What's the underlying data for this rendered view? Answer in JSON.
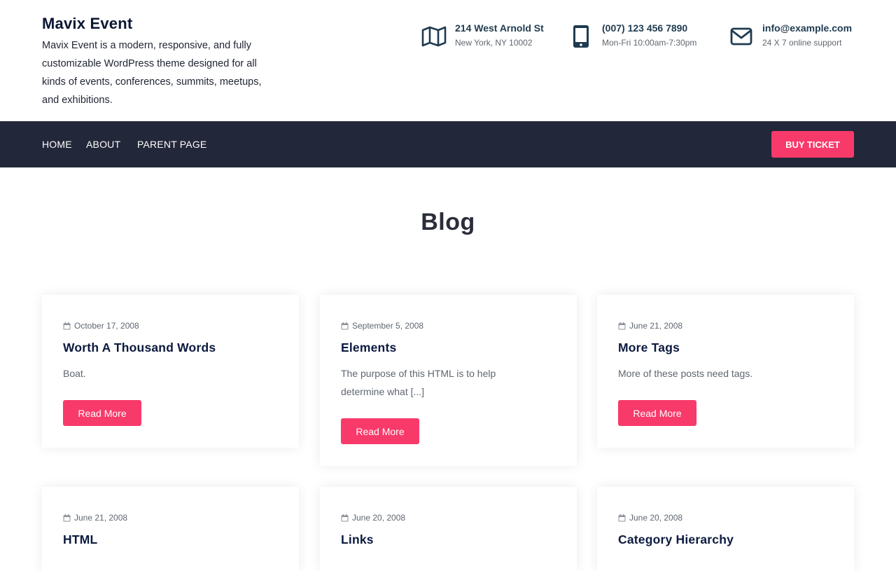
{
  "site": {
    "title": "Mavix Event",
    "description": "Mavix Event is a modern, responsive, and fully customizable WordPress theme designed for all kinds of events, conferences, summits, meetups, and exhibitions."
  },
  "contacts": {
    "address": {
      "icon": "map-icon",
      "line1": "214 West Arnold St",
      "line2": "New York, NY 10002"
    },
    "phone": {
      "icon": "mobile-phone-icon",
      "line1": "(007) 123 456 7890",
      "line2": "Mon-Fri 10:00am-7:30pm"
    },
    "email": {
      "icon": "envelope-icon",
      "line1": "info@example.com",
      "line2": "24 X 7 online support"
    }
  },
  "nav": {
    "items": [
      {
        "label": "HOME"
      },
      {
        "label": "ABOUT"
      },
      {
        "label": "PARENT PAGE"
      }
    ],
    "cta": "BUY TICKET"
  },
  "page": {
    "title": "Blog"
  },
  "posts": [
    {
      "date": "October 17, 2008",
      "title": "Worth A Thousand Words",
      "excerpt": "Boat.",
      "button": "Read More"
    },
    {
      "date": "September 5, 2008",
      "title": "Elements",
      "excerpt": "The purpose of this HTML is to help determine what [...]",
      "button": "Read More"
    },
    {
      "date": "June 21, 2008",
      "title": "More Tags",
      "excerpt": "More of these posts need tags.",
      "button": "Read More"
    },
    {
      "date": "June 21, 2008",
      "title": "HTML",
      "excerpt": "",
      "button": ""
    },
    {
      "date": "June 20, 2008",
      "title": "Links",
      "excerpt": "",
      "button": ""
    },
    {
      "date": "June 20, 2008",
      "title": "Category Hierarchy",
      "excerpt": "",
      "button": ""
    }
  ],
  "colors": {
    "accent": "#f83a6b",
    "navbar": "#23273a",
    "heading": "#0c1a3f",
    "icon": "#1f3b50"
  }
}
